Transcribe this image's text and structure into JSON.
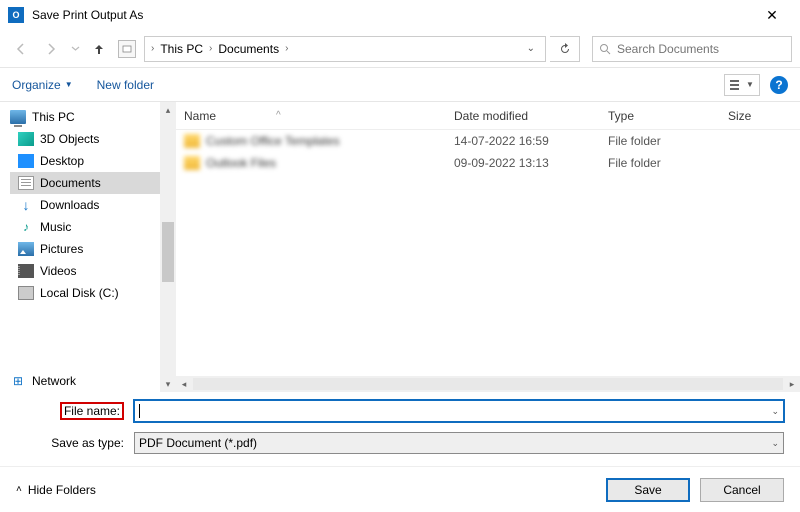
{
  "window": {
    "title": "Save Print Output As"
  },
  "nav": {
    "breadcrumb": {
      "root": "This PC",
      "folder": "Documents"
    },
    "search_placeholder": "Search Documents"
  },
  "toolbar": {
    "organize": "Organize",
    "newfolder": "New folder"
  },
  "tree": {
    "root": "This PC",
    "items": [
      {
        "label": "3D Objects"
      },
      {
        "label": "Desktop"
      },
      {
        "label": "Documents"
      },
      {
        "label": "Downloads"
      },
      {
        "label": "Music"
      },
      {
        "label": "Pictures"
      },
      {
        "label": "Videos"
      },
      {
        "label": "Local Disk (C:)"
      }
    ],
    "network": "Network"
  },
  "list": {
    "columns": {
      "name": "Name",
      "date": "Date modified",
      "type": "Type",
      "size": "Size"
    },
    "sortglyph": "^",
    "rows": [
      {
        "name": "Custom Office Templates",
        "date": "14-07-2022 16:59",
        "type": "File folder"
      },
      {
        "name": "Outlook Files",
        "date": "09-09-2022 13:13",
        "type": "File folder"
      }
    ]
  },
  "inputs": {
    "filename_label": "File name:",
    "filename_value": "",
    "saveastype_label": "Save as type:",
    "saveastype_value": "PDF Document (*.pdf)"
  },
  "footer": {
    "hidefolders": "Hide Folders",
    "save": "Save",
    "cancel": "Cancel"
  }
}
